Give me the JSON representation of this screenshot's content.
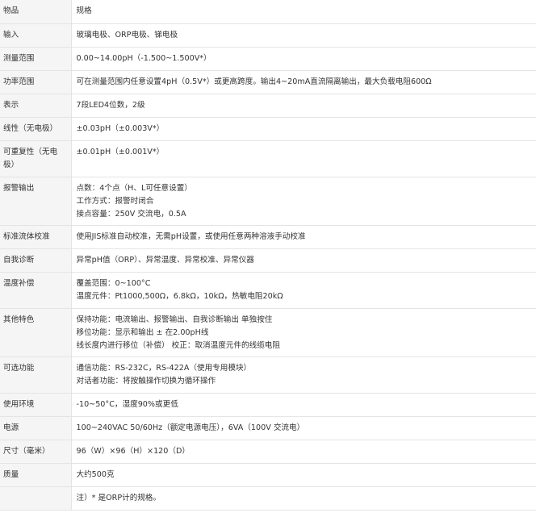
{
  "spec_table": {
    "header": {
      "label": "物品",
      "value": "规格"
    },
    "rows": [
      {
        "label": "输入",
        "lines": [
          "玻璃电极、ORP电极、锑电极"
        ]
      },
      {
        "label": "测量范围",
        "lines": [
          "0.00~14.00pH（-1.500~1.500V*）"
        ]
      },
      {
        "label": "功率范围",
        "lines": [
          "可在测量范围内任意设置4pH（0.5V*）或更高跨度。输出4~20mA直流隔离输出，最大负载电阻600Ω"
        ]
      },
      {
        "label": "表示",
        "lines": [
          "7段LED4位数，2级"
        ]
      },
      {
        "label": "线性（无电极）",
        "lines": [
          "±0.03pH（±0.003V*）"
        ]
      },
      {
        "label": "可重复性（无电极）",
        "lines": [
          "±0.01pH（±0.001V*）"
        ]
      },
      {
        "label": "报警输出",
        "lines": [
          "点数：4个点（H、L可任意设置）",
          "工作方式：报警时闭合",
          "接点容量：250V 交流电，0.5A"
        ]
      },
      {
        "label": "标准流体校准",
        "lines": [
          "使用JIS标准自动校准，无需pH设置，或使用任意两种溶液手动校准"
        ]
      },
      {
        "label": "自我诊断",
        "lines": [
          "异常pH值（ORP）、异常温度、异常校准、异常仪器"
        ]
      },
      {
        "label": "温度补偿",
        "lines": [
          "覆盖范围：0~100°C",
          "温度元件：Pt1000,500Ω，6.8kΩ，10kΩ，热敏电阻20kΩ"
        ]
      },
      {
        "label": "其他特色",
        "lines": [
          "保持功能：电流输出、报警输出、自我诊断输出 单独按住",
          "移位功能：显示和输出 ± 在2.00pH线",
          "线长度内进行移位（补偿） 校正：取消温度元件的线缆电阻"
        ]
      },
      {
        "label": "可选功能",
        "lines": [
          "通信功能：RS-232C，RS-422A（使用专用模块）",
          "对话者功能：将按触操作切换为循环操作"
        ]
      },
      {
        "label": "使用环境",
        "lines": [
          "-10~50°C，湿度90%或更低"
        ]
      },
      {
        "label": "电源",
        "lines": [
          "100~240VAC 50/60Hz（额定电源电压），6VA（100V 交流电）"
        ]
      },
      {
        "label": "尺寸（毫米）",
        "lines": [
          "96（W）×96（H）×120（D）"
        ]
      },
      {
        "label": "质量",
        "lines": [
          "大约500克"
        ]
      },
      {
        "label": "",
        "lines": [
          "注）* 是ORP计的规格。"
        ]
      }
    ]
  }
}
